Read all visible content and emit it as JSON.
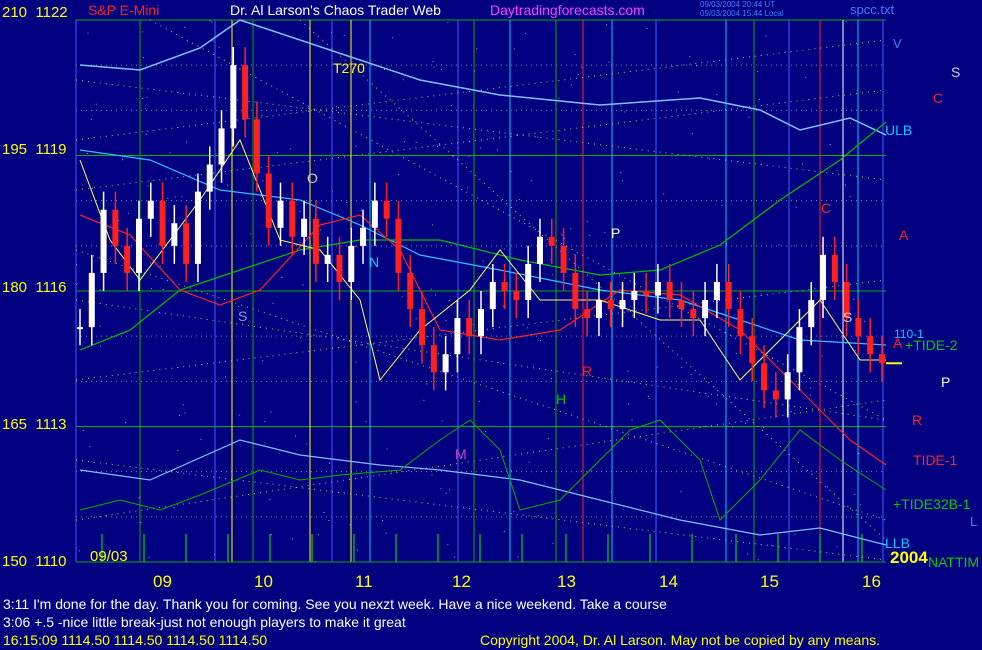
{
  "header": {
    "symbol": "S&P E-Mini",
    "title": "Dr. Al Larson's Chaos Trader Web",
    "site": "Daytradingforecasts.com",
    "file": "spcc.txt",
    "stamp1": "09/03/2004 20:44 UT",
    "stamp2": "09/03/2004 15:44 Local",
    "date_start": "09/03",
    "year": "2004"
  },
  "messages": [
    "3:11 I'm done for the day. Thank you for coming. See you nexzt week. Have a nice weekend. Take a course",
    "3:06 +.5 -nice little break-just not enough players to make it great"
  ],
  "status_line": "16:15:09  1114.50 1114.50 1114.50 1114.50",
  "copyright": "Copyright 2004, Dr. Al Larson. May not be copied by any means.",
  "chart_data": {
    "type": "candlestick",
    "y_axis_labels": [
      {
        "pos": 210,
        "price": 1122
      },
      {
        "pos": 195,
        "price": 1119
      },
      {
        "pos": 180,
        "price": 1116
      },
      {
        "pos": 165,
        "price": 1113
      },
      {
        "pos": 150,
        "price": 1110
      }
    ],
    "ylim": [
      1110,
      1122
    ],
    "x_ticks": [
      "09",
      "10",
      "11",
      "12",
      "13",
      "14",
      "15",
      "16"
    ],
    "close_prices": [
      1115.2,
      1116.4,
      1117.8,
      1117.0,
      1116.4,
      1117.6,
      1118.0,
      1117.0,
      1117.5,
      1116.6,
      1118.2,
      1118.8,
      1119.6,
      1121.0,
      1119.8,
      1118.6,
      1117.4,
      1118.0,
      1117.2,
      1117.6,
      1116.6,
      1116.8,
      1116.2,
      1117.0,
      1117.4,
      1118.0,
      1117.6,
      1116.4,
      1115.6,
      1114.8,
      1114.2,
      1114.6,
      1115.4,
      1115.0,
      1115.6,
      1116.2,
      1116.0,
      1115.8,
      1116.6,
      1117.2,
      1117.0,
      1116.4,
      1115.6,
      1115.4,
      1115.8,
      1115.6,
      1115.8,
      1116.0,
      1115.9,
      1116.2,
      1115.8,
      1115.6,
      1115.4,
      1115.8,
      1116.2,
      1115.6,
      1115.0,
      1114.4,
      1113.8,
      1113.6,
      1114.2,
      1115.2,
      1115.8,
      1116.8,
      1116.2,
      1115.4,
      1115.0,
      1114.6,
      1114.4
    ],
    "overlay_labels": [
      "T270",
      "O",
      "N",
      "P",
      "S",
      "S",
      "R",
      "H",
      "M",
      "C",
      "A",
      "C",
      "S",
      "ULB",
      "LLB",
      "V",
      "P",
      "R",
      "A",
      "110-1",
      "+TIDE-2",
      "TIDE-1",
      "+TIDE32B-1",
      "NATTIM",
      "L"
    ],
    "colors": {
      "background": "#000080",
      "price_up": "#ffffff",
      "price_down": "#ff0000",
      "axis_labels": "#ffff00",
      "grid": "#00cc00"
    }
  }
}
